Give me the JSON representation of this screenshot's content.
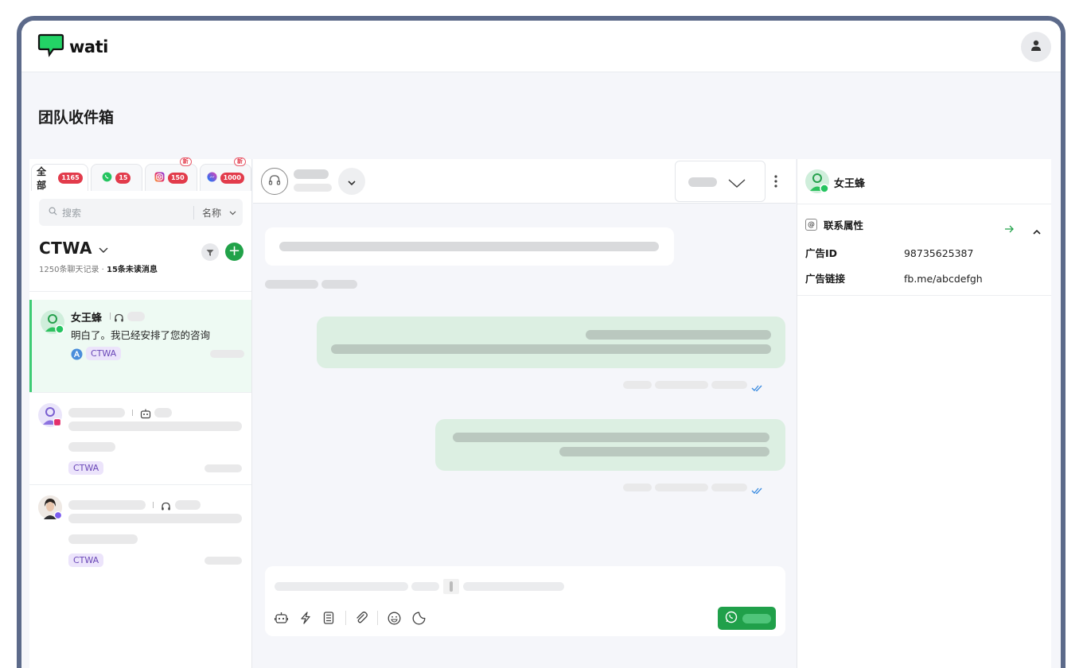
{
  "app": {
    "logo_text": "wati",
    "page_title": "团队收件箱"
  },
  "colors": {
    "brand": "#23d366",
    "send": "#20a04a",
    "badge": "#e23b4b",
    "active_row": "#eefaf3",
    "tag_bg": "#ece4fb",
    "tag_text": "#6b49b8"
  },
  "tabs": [
    {
      "label": "全部",
      "count": "1165",
      "icon": "all"
    },
    {
      "label": "",
      "count": "15",
      "icon": "whatsapp-icon"
    },
    {
      "label": "",
      "count": "150",
      "icon": "instagram-icon",
      "new": "新"
    },
    {
      "label": "",
      "count": "1000",
      "icon": "messenger-icon",
      "new": "新"
    }
  ],
  "search": {
    "placeholder": "搜索",
    "sort_label": "名称"
  },
  "list": {
    "title": "CTWA",
    "records": "1250条聊天记录",
    "unread": "15条未读消息"
  },
  "conversations": [
    {
      "name": "女王蜂",
      "message": "明白了。我已经安排了您的咨询",
      "tag": "CTWA"
    },
    {
      "tag": "CTWA"
    },
    {
      "tag": "CTWA"
    }
  ],
  "contact": {
    "name": "女王蜂",
    "section_title": "联系属性",
    "attributes": [
      {
        "key": "广告ID",
        "value": "98735625387"
      },
      {
        "key": "广告链接",
        "value": "fb.me/abcdefgh"
      }
    ]
  }
}
